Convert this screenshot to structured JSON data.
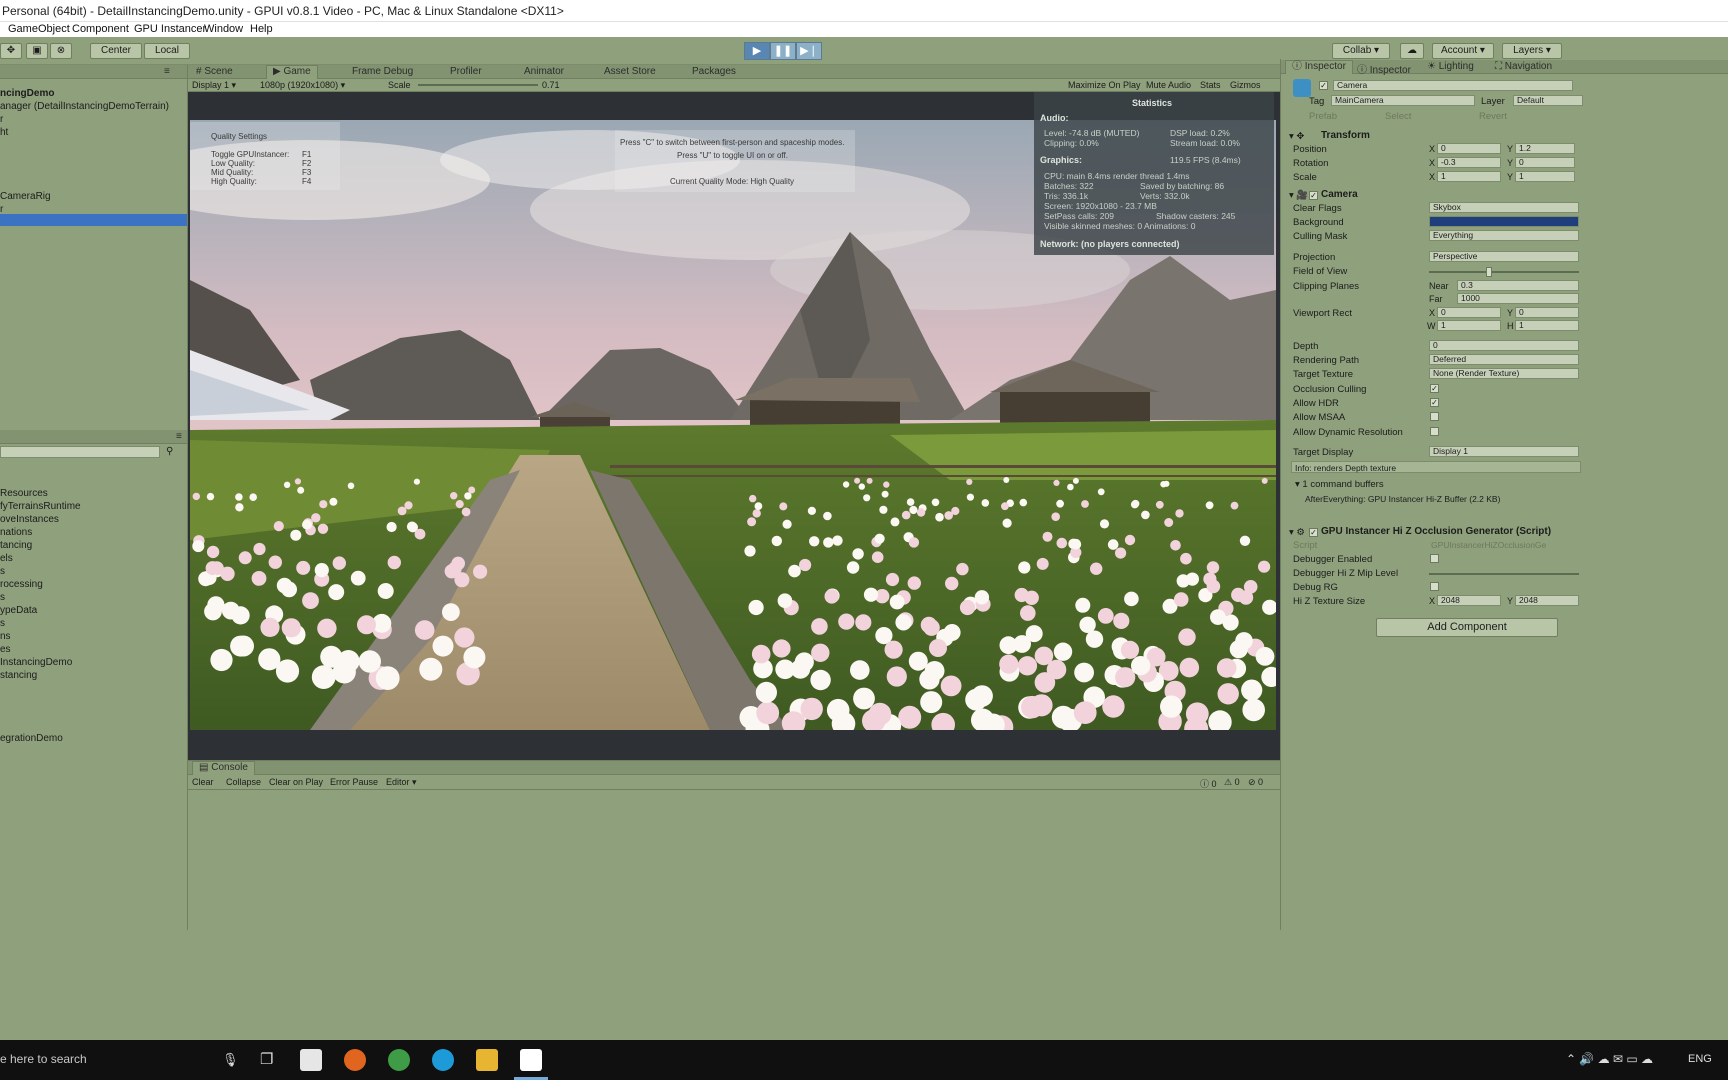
{
  "window": {
    "title": "Personal (64bit) - DetailInstancingDemo.unity - GPUI v0.8.1 Video - PC, Mac & Linux Standalone <DX11>"
  },
  "menu": [
    "GameObject",
    "Component",
    "GPU Instancer",
    "Window",
    "Help"
  ],
  "toolbar": {
    "center": "Center",
    "local": "Local",
    "collab": "Collab",
    "account": "Account",
    "layers": "Layers"
  },
  "scene_tabs": [
    "Scene",
    "Game",
    "Frame Debug",
    "Profiler",
    "Animator",
    "Asset Store",
    "Packages"
  ],
  "game_bar": {
    "display": "Display 1",
    "resolution": "1080p (1920x1080)",
    "scale_label": "Scale",
    "scale_value": "0.71",
    "maximize": "Maximize On Play",
    "mute": "Mute Audio",
    "stats": "Stats",
    "gizmos": "Gizmos"
  },
  "hierarchy": {
    "items": [
      "ncingDemo",
      "anager (DetailInstancingDemoTerrain)",
      "r",
      "ht",
      "CameraRig",
      "r"
    ]
  },
  "project": {
    "items": [
      "Resources",
      "fyTerrainsRuntime",
      "oveInstances",
      "nations",
      "tancing",
      "els",
      "s",
      "rocessing",
      "s",
      "ypeData",
      "s",
      "ns",
      "es",
      "InstancingDemo",
      "stancing",
      "egrationDemo"
    ]
  },
  "overlay": {
    "quality_title": "Quality Settings",
    "toggle": "Toggle GPUInstancer:",
    "toggle_key": "F1",
    "low": "Low Quality:",
    "low_key": "F2",
    "mid": "Mid Quality:",
    "mid_key": "F3",
    "high": "High Quality:",
    "high_key": "F4",
    "hint1": "Press \"C\" to switch between first-person and spaceship modes.",
    "hint2": "Press \"U\" to toggle UI on or off.",
    "current_mode": "Current Quality Mode: High Quality"
  },
  "stats": {
    "title": "Statistics",
    "audio": "Audio:",
    "level": "Level: -74.8 dB (MUTED)",
    "dsp": "DSP load: 0.2%",
    "clipping": "Clipping: 0.0%",
    "stream": "Stream load: 0.0%",
    "graphics": "Graphics:",
    "fps": "119.5 FPS (8.4ms)",
    "cpu": "CPU: main 8.4ms  render thread 1.4ms",
    "batches": "Batches: 322",
    "saved": "Saved by batching: 86",
    "tris": "Tris: 336.1k",
    "verts": "Verts: 332.0k",
    "screen": "Screen: 1920x1080 - 23.7 MB",
    "setpass": "SetPass calls: 209",
    "shadow": "Shadow casters: 245",
    "skinned": "Visible skinned meshes: 0  Animations: 0",
    "network": "Network: (no players connected)"
  },
  "console": {
    "tab": "Console",
    "buttons": [
      "Clear",
      "Collapse",
      "Clear on Play",
      "Error Pause",
      "Editor"
    ],
    "counts": [
      "0",
      "0",
      "0"
    ]
  },
  "inspector": {
    "tabs": [
      "Inspector",
      "Inspector",
      "Lighting",
      "Navigation"
    ],
    "object_name": "Camera",
    "tag_label": "Tag",
    "tag": "MainCamera",
    "layer_label": "Layer",
    "layer": "Default",
    "prefab": "Prefab",
    "select": "Select",
    "revert": "Revert",
    "transform": {
      "title": "Transform",
      "position": "Position",
      "pos_x": "0",
      "pos_y": "1.2",
      "rotation": "Rotation",
      "rot_x": "-0.3",
      "rot_y": "0",
      "scale": "Scale",
      "scale_x": "1",
      "scale_y": "1"
    },
    "camera": {
      "title": "Camera",
      "clear_flags": "Clear Flags",
      "clear_flags_v": "Skybox",
      "background": "Background",
      "culling": "Culling Mask",
      "culling_v": "Everything",
      "projection": "Projection",
      "projection_v": "Perspective",
      "fov": "Field of View",
      "clipping": "Clipping Planes",
      "near": "Near",
      "near_v": "0.3",
      "far": "Far",
      "far_v": "1000",
      "viewport": "Viewport Rect",
      "vx": "0",
      "vy": "0",
      "vw": "1",
      "vh": "1",
      "depth": "Depth",
      "depth_v": "0",
      "rendering": "Rendering Path",
      "rendering_v": "Deferred",
      "target_tex": "Target Texture",
      "target_tex_v": "None (Render Texture)",
      "occlusion": "Occlusion Culling",
      "hdr": "Allow HDR",
      "msaa": "Allow MSAA",
      "dynres": "Allow Dynamic Resolution",
      "target_display": "Target Display",
      "target_display_v": "Display 1",
      "info": "Info: renders Depth texture",
      "cmd_buffers": "1 command buffers",
      "cmd_detail": "AfterEverything: GPU Instancer Hi-Z Buffer (2.2 KB)"
    },
    "hiz": {
      "title": "GPU Instancer Hi Z Occlusion Generator (Script)",
      "script": "Script",
      "script_v": "GPUInstancerHiZOcclusionGe",
      "debugger": "Debugger Enabled",
      "mip": "Debugger Hi Z Mip Level",
      "rg": "Debug RG",
      "texsize": "Hi Z Texture Size",
      "tx": "2048",
      "ty": "2048"
    },
    "add_component": "Add Component"
  },
  "taskbar": {
    "search": "e here to search",
    "lang": "ENG"
  }
}
